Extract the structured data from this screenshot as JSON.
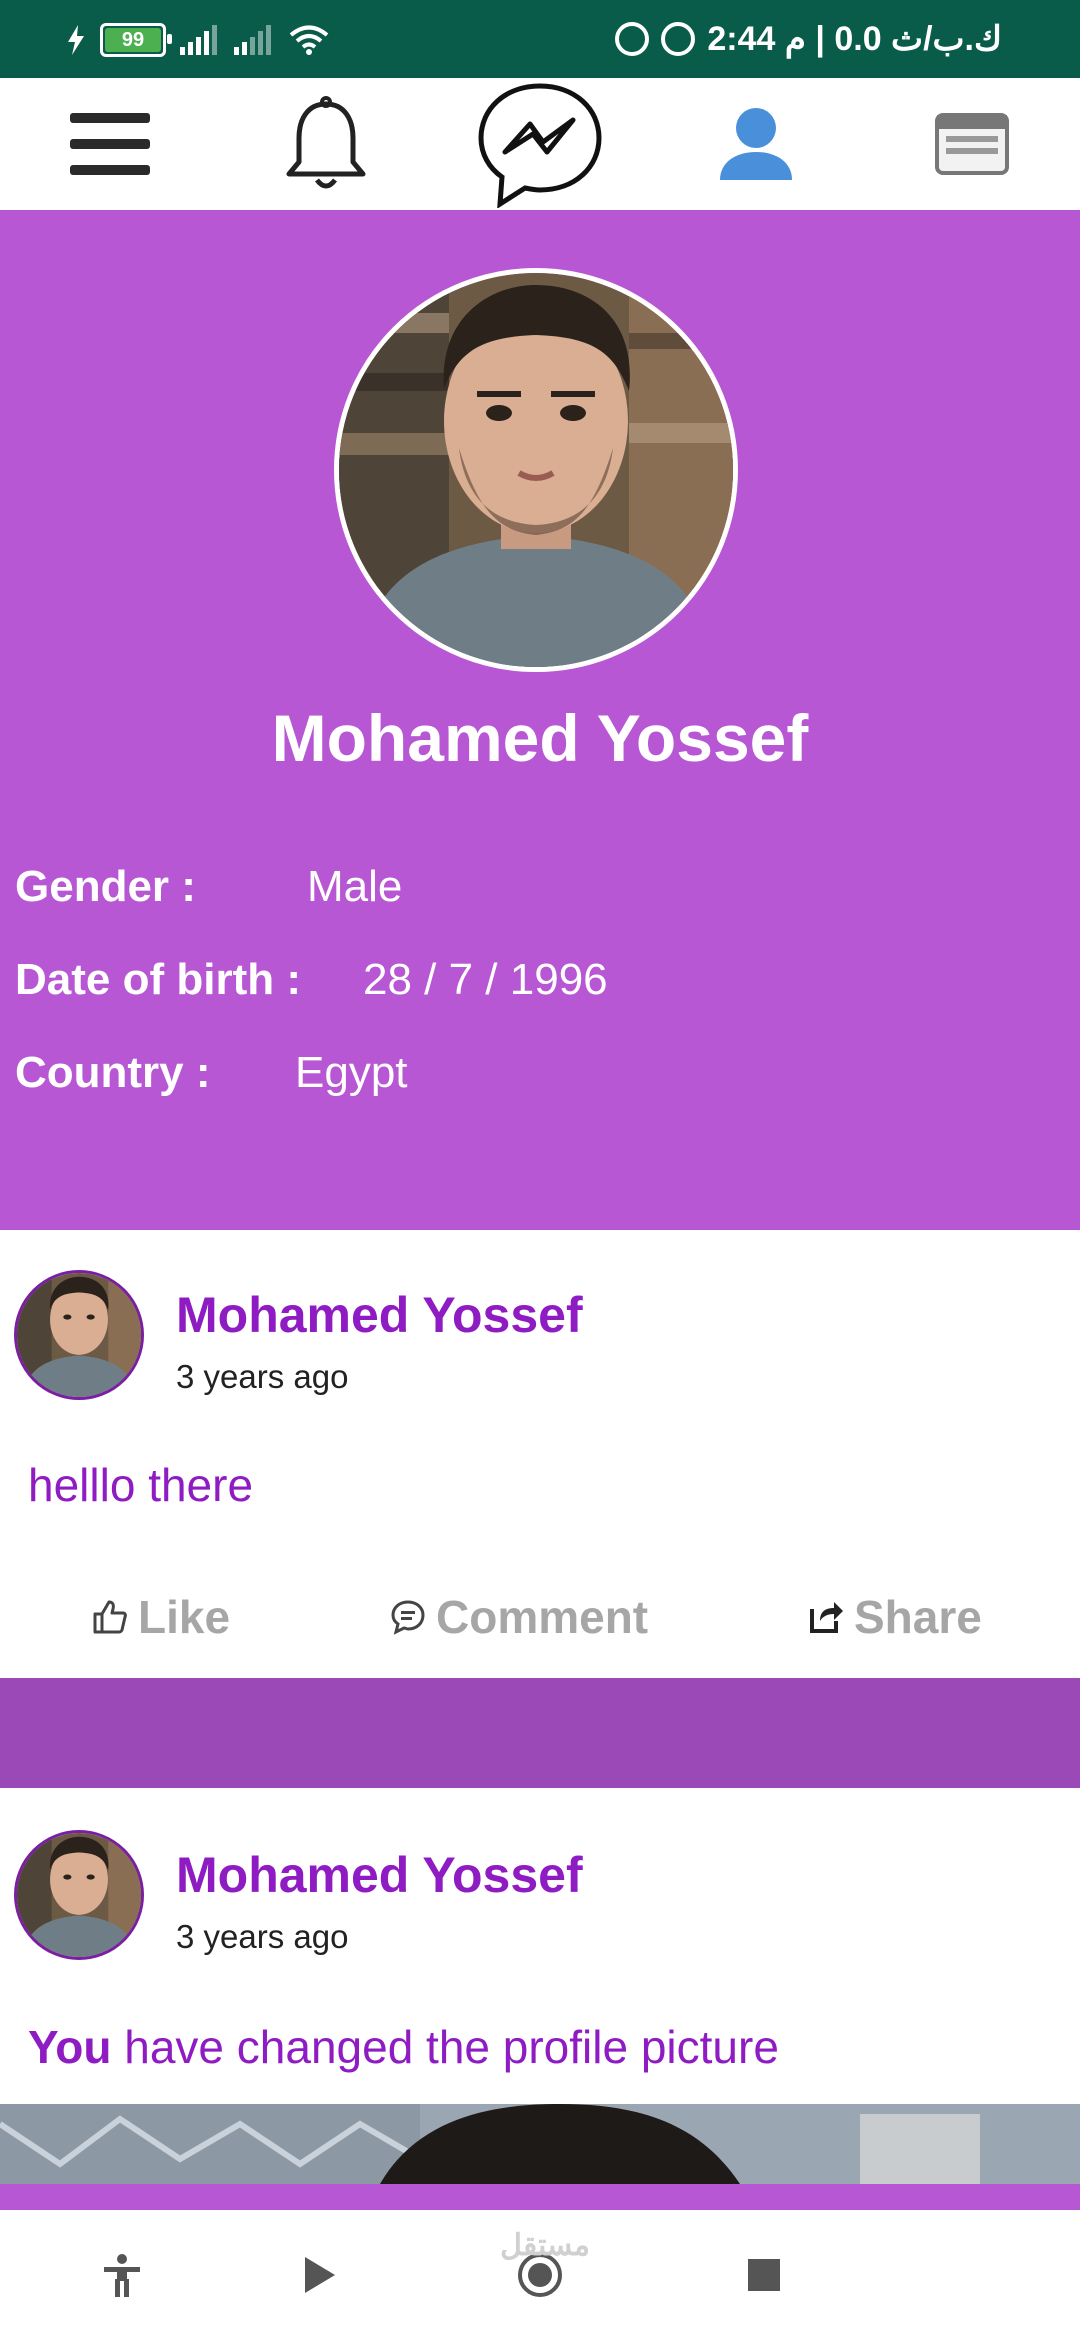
{
  "status_bar": {
    "battery_level": "99",
    "right_text": "ك.ب/ث 0.0 | م 2:44"
  },
  "top_nav": {
    "items": [
      "menu-icon",
      "bell-icon",
      "messenger-icon",
      "profile-icon",
      "news-icon"
    ],
    "active": "profile-icon",
    "active_color": "#4a8fd9"
  },
  "profile": {
    "name": "Mohamed Yossef",
    "gender_label": "Gender :",
    "gender_value": "Male",
    "dob_label": "Date of birth :",
    "dob_value": "28 / 7 / 1996",
    "country_label": "Country :",
    "country_value": "Egypt",
    "header_color": "#b857d4"
  },
  "posts": [
    {
      "author": "Mohamed Yossef",
      "time": "3 years ago",
      "text": "helllo there",
      "actions": {
        "like": "Like",
        "comment": "Comment",
        "share": "Share"
      }
    },
    {
      "author": "Mohamed Yossef",
      "time": "3 years ago",
      "text_bold": "You",
      "text_rest": " have changed the profile picture"
    }
  ],
  "bottom_nav": {
    "items": [
      "accessibility-icon",
      "back-icon",
      "home-icon",
      "recents-icon"
    ],
    "watermark": "مستقل"
  },
  "colors": {
    "accent": "#8e1cc2",
    "divider": "#9c49b8",
    "status_bar": "#0a5c4a"
  }
}
